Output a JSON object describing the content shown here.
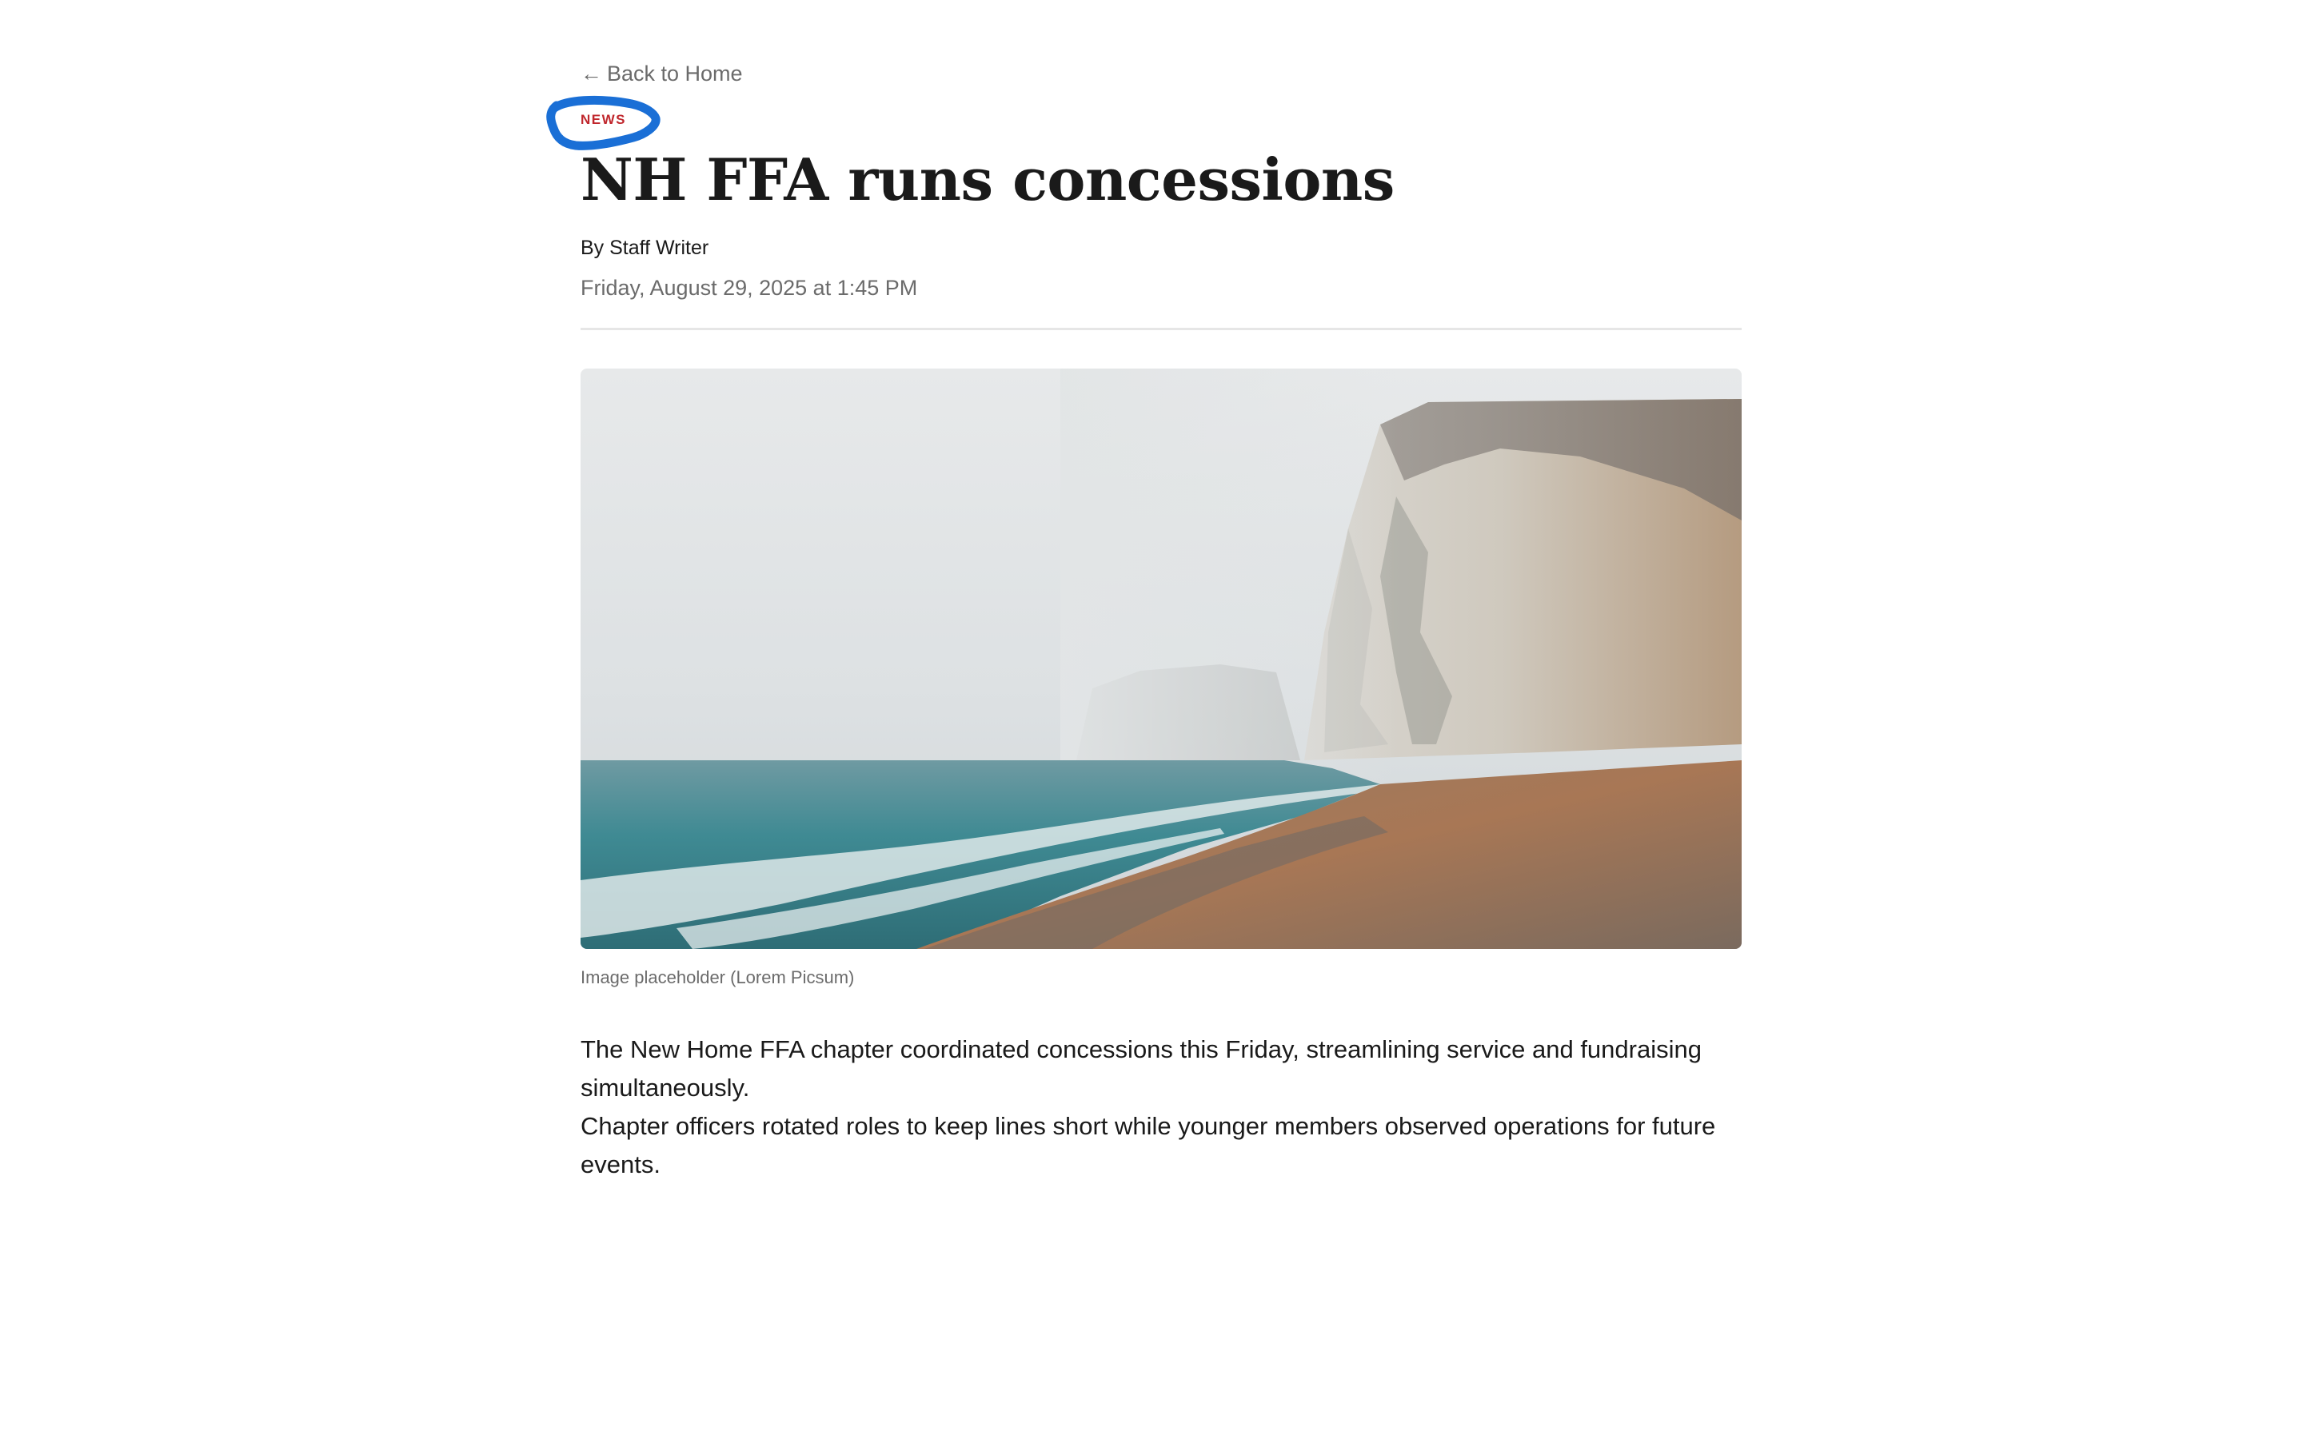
{
  "nav": {
    "back_arrow": "←",
    "back_label": "Back to Home"
  },
  "article": {
    "category": "NEWS",
    "headline": "NH FFA runs concessions",
    "byline": "By Staff Writer",
    "date": "Friday, August 29, 2025 at 1:45 PM",
    "image_caption": "Image placeholder (Lorem Picsum)",
    "paragraphs": [
      "The New Home FFA chapter coordinated concessions this Friday, streamlining service and fundraising simultaneously.",
      "Chapter officers rotated roles to keep lines short while younger members observed operations for future events."
    ]
  },
  "colors": {
    "category": "#c0272d",
    "annotation": "#1a6fd6",
    "muted_text": "#6b6b6b",
    "divider": "#e6e6e6"
  }
}
